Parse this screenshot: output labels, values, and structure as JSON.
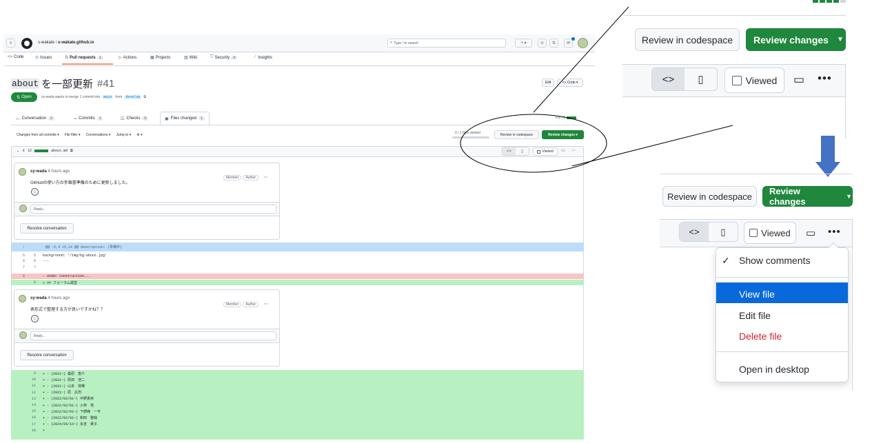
{
  "header": {
    "owner": "s-wakate",
    "sep": "/",
    "repo": "s-wakate.github.io",
    "search_placeholder": "Type / to search"
  },
  "nav": [
    {
      "label": "Code",
      "icon": "code-icon",
      "count": ""
    },
    {
      "label": "Issues",
      "icon": "issue-icon",
      "count": ""
    },
    {
      "label": "Pull requests",
      "icon": "pull-request-icon",
      "count": "1"
    },
    {
      "label": "Actions",
      "icon": "play-icon",
      "count": ""
    },
    {
      "label": "Projects",
      "icon": "table-icon",
      "count": ""
    },
    {
      "label": "Wiki",
      "icon": "book-icon",
      "count": ""
    },
    {
      "label": "Security",
      "icon": "shield-icon",
      "count": "4"
    },
    {
      "label": "Insights",
      "icon": "graph-icon",
      "count": ""
    }
  ],
  "pr": {
    "title_code": "about",
    "title_text": "を一部更新",
    "number": "#41",
    "edit": "Edit",
    "code_btn": "Code",
    "status": "Open",
    "meta_pre": "sy-wada wants to merge 1 commit into",
    "base": "main",
    "from": "from",
    "head": "develop"
  },
  "tabs": [
    {
      "label": "Conversation",
      "count": "2"
    },
    {
      "label": "Commits",
      "count": "1"
    },
    {
      "label": "Checks",
      "count": "0"
    },
    {
      "label": "Files changed",
      "count": "1"
    }
  ],
  "diffstat": "+11 −1",
  "toolbar": {
    "changes_from": "Changes from all commits",
    "file_filter": "File filter",
    "conversations": "Conversations",
    "jump_to": "Jump to",
    "files_viewed": "0 / 1 files viewed",
    "review_codespace": "Review in codespace",
    "review_changes": "Review changes"
  },
  "file": {
    "lines_changed": "12",
    "name": "about.md",
    "viewed": "Viewed"
  },
  "comments": [
    {
      "author": "sy-wada",
      "time": "4 hours ago",
      "body": "GitHubの使い方の手順書準備のために更新しました。",
      "member": "Member",
      "author_badge": "Author",
      "reply": "Reply...",
      "resolve": "Resolve conversation"
    },
    {
      "author": "sy-wada",
      "time": "4 hours ago",
      "body": "表形式で整理する方が良いですかね？？",
      "member": "Member",
      "author_badge": "Author",
      "reply": "Reply...",
      "resolve": "Resolve conversation"
    }
  ],
  "hunk": "@@ -5,4 +5,14 @@ description: (準備中)",
  "diff_lines": [
    {
      "old": "5",
      "new": "5",
      "text": "background: '/img/bg-about.jpg'",
      "kind": "ctx"
    },
    {
      "old": "6",
      "new": "6",
      "text": "---",
      "kind": "ctx"
    },
    {
      "old": "7",
      "new": "7",
      "text": "",
      "kind": "ctx"
    },
    {
      "old": "8",
      "new": "",
      "text": "- Under Construction...",
      "kind": "del"
    },
    {
      "old": "",
      "new": "8",
      "text": "+ ## フォーラム運営",
      "kind": "add"
    }
  ],
  "diff_lines2": [
    {
      "new": "9",
      "text": "+ - (2021~) 桑原　恵介"
    },
    {
      "new": "10",
      "text": "+ - (2021~) 原田　浩二"
    },
    {
      "new": "11",
      "text": "+ - (2021~) 山本　将暉"
    },
    {
      "new": "12",
      "text": "+ - (2021~) 原　広司"
    },
    {
      "new": "13",
      "text": "+ - (2022/02/01~) 中野貴央"
    },
    {
      "new": "14",
      "text": "+ - (2022/02/01~) 小林　亮"
    },
    {
      "new": "15",
      "text": "+ - (2022/02/01~) 下野峰　一平"
    },
    {
      "new": "16",
      "text": "+ - (2022/02/01~) 和田　聖哉"
    },
    {
      "new": "17",
      "text": "+ - (2024/05/16~) 永吉　貴子"
    },
    {
      "new": "18",
      "text": "+"
    }
  ],
  "zoom": {
    "review_codespace": "Review in codespace",
    "review_changes": "Review changes",
    "viewed": "Viewed",
    "menu": [
      "Show comments",
      "View file",
      "Edit file",
      "Delete file",
      "Open in desktop"
    ]
  },
  "colors": {
    "green": "#1f883d",
    "del": "#f9c4c4",
    "add": "#b8f0c2",
    "hunk": "#bcdcfa",
    "selected": "#0969da",
    "danger": "#cf222e"
  }
}
